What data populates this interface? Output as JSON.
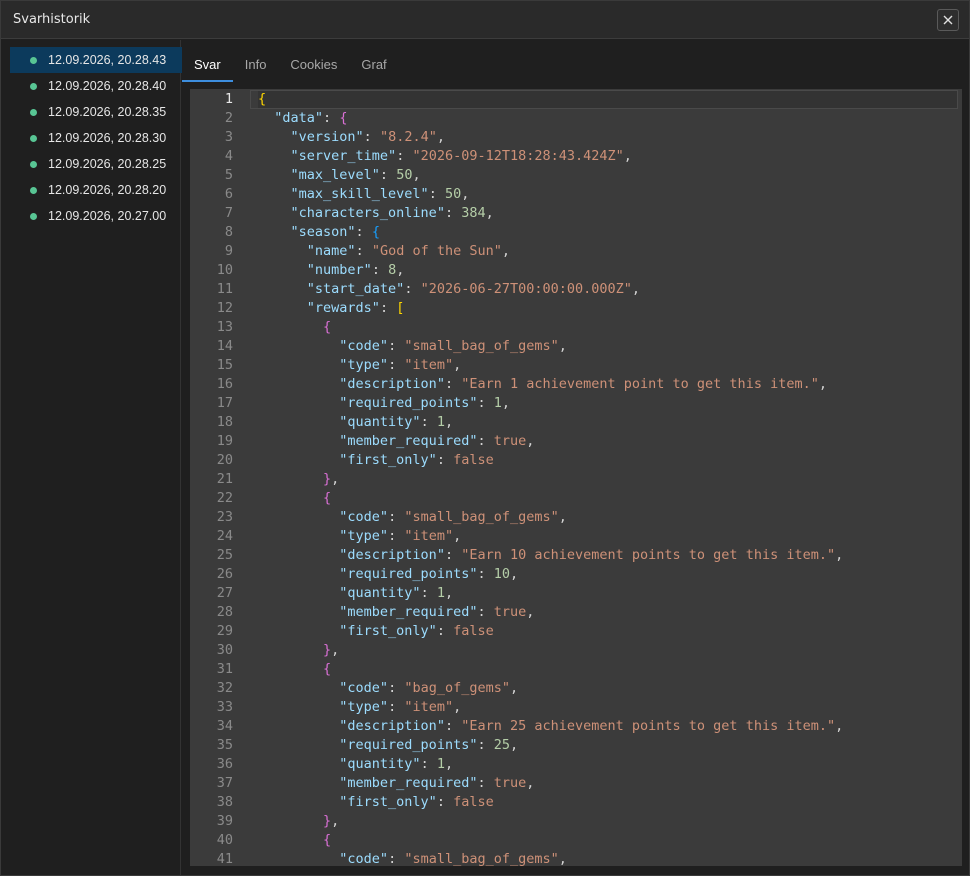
{
  "window": {
    "title": "Svarhistorik"
  },
  "history": [
    {
      "label": "12.09.2026, 20.28.43",
      "selected": true
    },
    {
      "label": "12.09.2026, 20.28.40",
      "selected": false
    },
    {
      "label": "12.09.2026, 20.28.35",
      "selected": false
    },
    {
      "label": "12.09.2026, 20.28.30",
      "selected": false
    },
    {
      "label": "12.09.2026, 20.28.25",
      "selected": false
    },
    {
      "label": "12.09.2026, 20.28.20",
      "selected": false
    },
    {
      "label": "12.09.2026, 20.27.00",
      "selected": false
    }
  ],
  "tabs": [
    {
      "label": "Svar",
      "active": true
    },
    {
      "label": "Info",
      "active": false
    },
    {
      "label": "Cookies",
      "active": false
    },
    {
      "label": "Graf",
      "active": false
    }
  ],
  "colors": {
    "status_dot": "#58c594",
    "selected_bg": "#0c3a5c",
    "tab_underline": "#3d8ede"
  },
  "icons": {
    "close": "close-icon"
  },
  "code_lines": [
    [
      [
        "br1",
        "{"
      ]
    ],
    [
      [
        "p",
        "  "
      ],
      [
        "k",
        "\"data\""
      ],
      [
        "p",
        ": "
      ],
      [
        "br2",
        "{"
      ]
    ],
    [
      [
        "p",
        "    "
      ],
      [
        "k",
        "\"version\""
      ],
      [
        "p",
        ": "
      ],
      [
        "s",
        "\"8.2.4\""
      ],
      [
        "p",
        ","
      ]
    ],
    [
      [
        "p",
        "    "
      ],
      [
        "k",
        "\"server_time\""
      ],
      [
        "p",
        ": "
      ],
      [
        "s",
        "\"2026-09-12T18:28:43.424Z\""
      ],
      [
        "p",
        ","
      ]
    ],
    [
      [
        "p",
        "    "
      ],
      [
        "k",
        "\"max_level\""
      ],
      [
        "p",
        ": "
      ],
      [
        "n",
        "50"
      ],
      [
        "p",
        ","
      ]
    ],
    [
      [
        "p",
        "    "
      ],
      [
        "k",
        "\"max_skill_level\""
      ],
      [
        "p",
        ": "
      ],
      [
        "n",
        "50"
      ],
      [
        "p",
        ","
      ]
    ],
    [
      [
        "p",
        "    "
      ],
      [
        "k",
        "\"characters_online\""
      ],
      [
        "p",
        ": "
      ],
      [
        "n",
        "384"
      ],
      [
        "p",
        ","
      ]
    ],
    [
      [
        "p",
        "    "
      ],
      [
        "k",
        "\"season\""
      ],
      [
        "p",
        ": "
      ],
      [
        "br3",
        "{"
      ]
    ],
    [
      [
        "p",
        "      "
      ],
      [
        "k",
        "\"name\""
      ],
      [
        "p",
        ": "
      ],
      [
        "s",
        "\"God of the Sun\""
      ],
      [
        "p",
        ","
      ]
    ],
    [
      [
        "p",
        "      "
      ],
      [
        "k",
        "\"number\""
      ],
      [
        "p",
        ": "
      ],
      [
        "n",
        "8"
      ],
      [
        "p",
        ","
      ]
    ],
    [
      [
        "p",
        "      "
      ],
      [
        "k",
        "\"start_date\""
      ],
      [
        "p",
        ": "
      ],
      [
        "s",
        "\"2026-06-27T00:00:00.000Z\""
      ],
      [
        "p",
        ","
      ]
    ],
    [
      [
        "p",
        "      "
      ],
      [
        "k",
        "\"rewards\""
      ],
      [
        "p",
        ": "
      ],
      [
        "br1",
        "["
      ]
    ],
    [
      [
        "p",
        "        "
      ],
      [
        "br2",
        "{"
      ]
    ],
    [
      [
        "p",
        "          "
      ],
      [
        "k",
        "\"code\""
      ],
      [
        "p",
        ": "
      ],
      [
        "s",
        "\"small_bag_of_gems\""
      ],
      [
        "p",
        ","
      ]
    ],
    [
      [
        "p",
        "          "
      ],
      [
        "k",
        "\"type\""
      ],
      [
        "p",
        ": "
      ],
      [
        "s",
        "\"item\""
      ],
      [
        "p",
        ","
      ]
    ],
    [
      [
        "p",
        "          "
      ],
      [
        "k",
        "\"description\""
      ],
      [
        "p",
        ": "
      ],
      [
        "s",
        "\"Earn 1 achievement point to get this item.\""
      ],
      [
        "p",
        ","
      ]
    ],
    [
      [
        "p",
        "          "
      ],
      [
        "k",
        "\"required_points\""
      ],
      [
        "p",
        ": "
      ],
      [
        "n",
        "1"
      ],
      [
        "p",
        ","
      ]
    ],
    [
      [
        "p",
        "          "
      ],
      [
        "k",
        "\"quantity\""
      ],
      [
        "p",
        ": "
      ],
      [
        "n",
        "1"
      ],
      [
        "p",
        ","
      ]
    ],
    [
      [
        "p",
        "          "
      ],
      [
        "k",
        "\"member_required\""
      ],
      [
        "p",
        ": "
      ],
      [
        "b",
        "true"
      ],
      [
        "p",
        ","
      ]
    ],
    [
      [
        "p",
        "          "
      ],
      [
        "k",
        "\"first_only\""
      ],
      [
        "p",
        ": "
      ],
      [
        "b",
        "false"
      ]
    ],
    [
      [
        "p",
        "        "
      ],
      [
        "br2",
        "}"
      ],
      [
        "p",
        ","
      ]
    ],
    [
      [
        "p",
        "        "
      ],
      [
        "br2",
        "{"
      ]
    ],
    [
      [
        "p",
        "          "
      ],
      [
        "k",
        "\"code\""
      ],
      [
        "p",
        ": "
      ],
      [
        "s",
        "\"small_bag_of_gems\""
      ],
      [
        "p",
        ","
      ]
    ],
    [
      [
        "p",
        "          "
      ],
      [
        "k",
        "\"type\""
      ],
      [
        "p",
        ": "
      ],
      [
        "s",
        "\"item\""
      ],
      [
        "p",
        ","
      ]
    ],
    [
      [
        "p",
        "          "
      ],
      [
        "k",
        "\"description\""
      ],
      [
        "p",
        ": "
      ],
      [
        "s",
        "\"Earn 10 achievement points to get this item.\""
      ],
      [
        "p",
        ","
      ]
    ],
    [
      [
        "p",
        "          "
      ],
      [
        "k",
        "\"required_points\""
      ],
      [
        "p",
        ": "
      ],
      [
        "n",
        "10"
      ],
      [
        "p",
        ","
      ]
    ],
    [
      [
        "p",
        "          "
      ],
      [
        "k",
        "\"quantity\""
      ],
      [
        "p",
        ": "
      ],
      [
        "n",
        "1"
      ],
      [
        "p",
        ","
      ]
    ],
    [
      [
        "p",
        "          "
      ],
      [
        "k",
        "\"member_required\""
      ],
      [
        "p",
        ": "
      ],
      [
        "b",
        "true"
      ],
      [
        "p",
        ","
      ]
    ],
    [
      [
        "p",
        "          "
      ],
      [
        "k",
        "\"first_only\""
      ],
      [
        "p",
        ": "
      ],
      [
        "b",
        "false"
      ]
    ],
    [
      [
        "p",
        "        "
      ],
      [
        "br2",
        "}"
      ],
      [
        "p",
        ","
      ]
    ],
    [
      [
        "p",
        "        "
      ],
      [
        "br2",
        "{"
      ]
    ],
    [
      [
        "p",
        "          "
      ],
      [
        "k",
        "\"code\""
      ],
      [
        "p",
        ": "
      ],
      [
        "s",
        "\"bag_of_gems\""
      ],
      [
        "p",
        ","
      ]
    ],
    [
      [
        "p",
        "          "
      ],
      [
        "k",
        "\"type\""
      ],
      [
        "p",
        ": "
      ],
      [
        "s",
        "\"item\""
      ],
      [
        "p",
        ","
      ]
    ],
    [
      [
        "p",
        "          "
      ],
      [
        "k",
        "\"description\""
      ],
      [
        "p",
        ": "
      ],
      [
        "s",
        "\"Earn 25 achievement points to get this item.\""
      ],
      [
        "p",
        ","
      ]
    ],
    [
      [
        "p",
        "          "
      ],
      [
        "k",
        "\"required_points\""
      ],
      [
        "p",
        ": "
      ],
      [
        "n",
        "25"
      ],
      [
        "p",
        ","
      ]
    ],
    [
      [
        "p",
        "          "
      ],
      [
        "k",
        "\"quantity\""
      ],
      [
        "p",
        ": "
      ],
      [
        "n",
        "1"
      ],
      [
        "p",
        ","
      ]
    ],
    [
      [
        "p",
        "          "
      ],
      [
        "k",
        "\"member_required\""
      ],
      [
        "p",
        ": "
      ],
      [
        "b",
        "true"
      ],
      [
        "p",
        ","
      ]
    ],
    [
      [
        "p",
        "          "
      ],
      [
        "k",
        "\"first_only\""
      ],
      [
        "p",
        ": "
      ],
      [
        "b",
        "false"
      ]
    ],
    [
      [
        "p",
        "        "
      ],
      [
        "br2",
        "}"
      ],
      [
        "p",
        ","
      ]
    ],
    [
      [
        "p",
        "        "
      ],
      [
        "br2",
        "{"
      ]
    ],
    [
      [
        "p",
        "          "
      ],
      [
        "k",
        "\"code\""
      ],
      [
        "p",
        ": "
      ],
      [
        "s",
        "\"small_bag_of_gems\""
      ],
      [
        "p",
        ","
      ]
    ]
  ]
}
